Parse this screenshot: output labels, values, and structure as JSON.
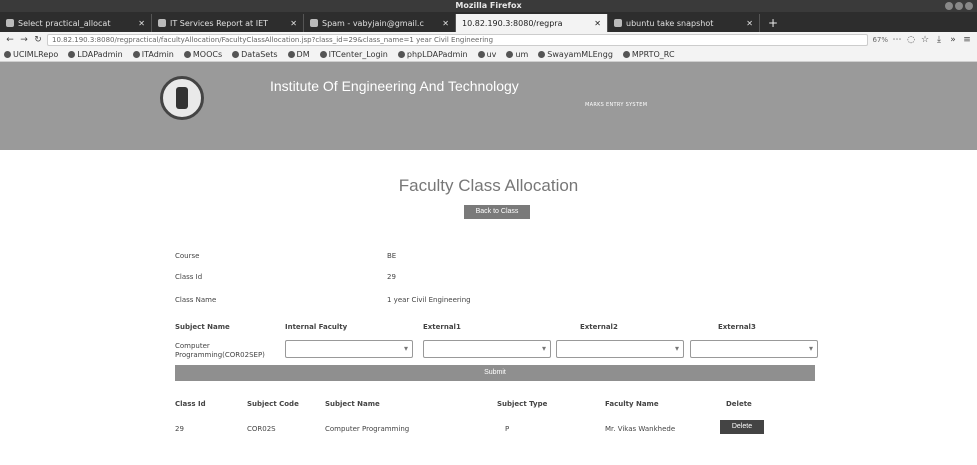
{
  "browser": {
    "window_title": "Mozilla Firefox",
    "tabs": [
      {
        "title": "Select practical_allocat",
        "active": false
      },
      {
        "title": "IT Services Report at IET",
        "active": false
      },
      {
        "title": "Spam - vabyjain@gmail.c",
        "active": false
      },
      {
        "title": "10.82.190.3:8080/regpra",
        "active": true
      },
      {
        "title": "ubuntu take snapshot",
        "active": false
      }
    ],
    "url": "10.82.190.3:8080/regpractical/facultyAllocation/FacultyClassAllocation.jsp?class_id=29&class_name=1 year Civil Engineering",
    "zoom": "67%",
    "bookmarks": [
      "UCIMLRepo",
      "LDAPadmin",
      "ITAdmin",
      "MOOCs",
      "DataSets",
      "DM",
      "ITCenter_Login",
      "phpLDAPadmin",
      "uv",
      "um",
      "SwayamMLEngg",
      "MPRTO_RC"
    ]
  },
  "header": {
    "title": "Institute Of Engineering And Technology",
    "subtitle": "MARKS ENTRY SYSTEM"
  },
  "page": {
    "title": "Faculty Class Allocation",
    "back_label": "Back to Class"
  },
  "info": {
    "course_label": "Course",
    "course_value": "BE",
    "class_id_label": "Class Id",
    "class_id_value": "29",
    "class_name_label": "Class Name",
    "class_name_value": "1 year Civil Engineering"
  },
  "allocation_form": {
    "headers": [
      "Subject Name",
      "Internal Faculty",
      "External1",
      "External2",
      "External3"
    ],
    "subject": "Computer Programming(COR02SEP)",
    "submit_label": "Submit"
  },
  "table": {
    "headers": [
      "Class Id",
      "Subject Code",
      "Subject Name",
      "Subject Type",
      "Faculty Name",
      "Delete"
    ],
    "rows": [
      {
        "class_id": "29",
        "subject_code": "COR02S",
        "subject_name": "Computer Programming",
        "subject_type": "P",
        "faculty_name": "Mr. Vikas Wankhede",
        "delete_label": "Delete"
      }
    ]
  }
}
